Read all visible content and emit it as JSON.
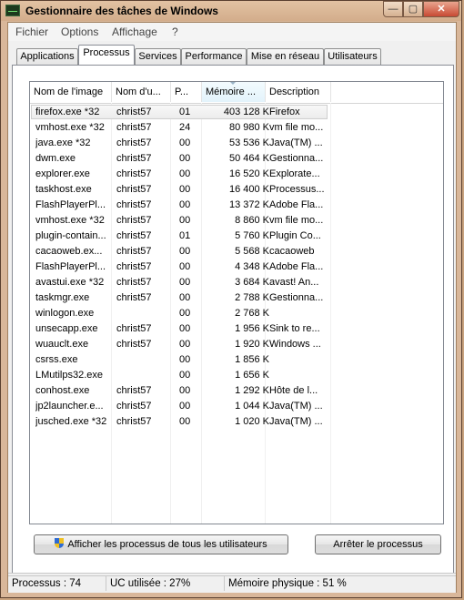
{
  "window": {
    "title": "Gestionnaire des tâches de Windows",
    "controls": {
      "minimize": "—",
      "maximize": "▢",
      "close": "✕"
    }
  },
  "menu": [
    "Fichier",
    "Options",
    "Affichage",
    "?"
  ],
  "tabs": [
    "Applications",
    "Processus",
    "Services",
    "Performance",
    "Mise en réseau",
    "Utilisateurs"
  ],
  "active_tab": "Processus",
  "columns": [
    "Nom de l'image",
    "Nom d'u...",
    "P...",
    "Mémoire ...",
    "Description"
  ],
  "rows": [
    [
      "firefox.exe *32",
      "christ57",
      "01",
      "403 128 K",
      "Firefox"
    ],
    [
      "vmhost.exe *32",
      "christ57",
      "24",
      "80 980 K",
      "vm file mo..."
    ],
    [
      "java.exe *32",
      "christ57",
      "00",
      "53 536 K",
      "Java(TM) ..."
    ],
    [
      "dwm.exe",
      "christ57",
      "00",
      "50 464 K",
      "Gestionna..."
    ],
    [
      "explorer.exe",
      "christ57",
      "00",
      "16 520 K",
      "Explorate..."
    ],
    [
      "taskhost.exe",
      "christ57",
      "00",
      "16 400 K",
      "Processus..."
    ],
    [
      "FlashPlayerPl...",
      "christ57",
      "00",
      "13 372 K",
      "Adobe Fla..."
    ],
    [
      "vmhost.exe *32",
      "christ57",
      "00",
      "8 860 K",
      "vm file mo..."
    ],
    [
      "plugin-contain...",
      "christ57",
      "01",
      "5 760 K",
      "Plugin Co..."
    ],
    [
      "cacaoweb.ex...",
      "christ57",
      "00",
      "5 568 K",
      "cacaoweb"
    ],
    [
      "FlashPlayerPl...",
      "christ57",
      "00",
      "4 348 K",
      "Adobe Fla..."
    ],
    [
      "avastui.exe *32",
      "christ57",
      "00",
      "3 684 K",
      "avast! An..."
    ],
    [
      "taskmgr.exe",
      "christ57",
      "00",
      "2 788 K",
      "Gestionna..."
    ],
    [
      "winlogon.exe",
      "",
      "00",
      "2 768 K",
      ""
    ],
    [
      "unsecapp.exe",
      "christ57",
      "00",
      "1 956 K",
      "Sink to re..."
    ],
    [
      "wuauclt.exe",
      "christ57",
      "00",
      "1 920 K",
      "Windows ..."
    ],
    [
      "csrss.exe",
      "",
      "00",
      "1 856 K",
      ""
    ],
    [
      "LMutilps32.exe",
      "",
      "00",
      "1 656 K",
      ""
    ],
    [
      "conhost.exe",
      "christ57",
      "00",
      "1 292 K",
      "Hôte de l..."
    ],
    [
      "jp2launcher.e...",
      "christ57",
      "00",
      "1 044 K",
      "Java(TM) ..."
    ],
    [
      "jusched.exe *32",
      "christ57",
      "00",
      "1 020 K",
      "Java(TM) ..."
    ]
  ],
  "buttons": {
    "show_all": "Afficher les processus de tous les utilisateurs",
    "end_process": "Arrêter le processus"
  },
  "status": {
    "processes": "Processus : 74",
    "cpu": "UC utilisée : 27%",
    "memory": "Mémoire physique : 51 %"
  }
}
